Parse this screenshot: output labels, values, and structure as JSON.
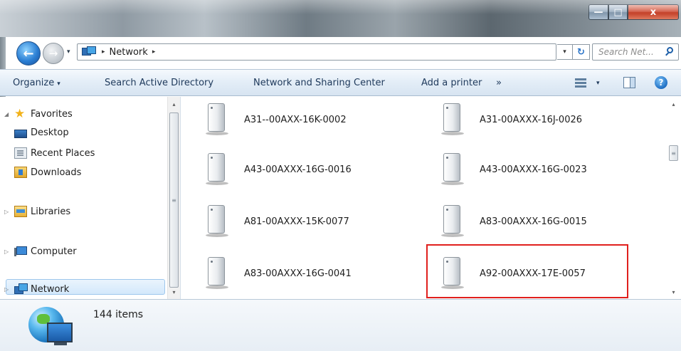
{
  "window": {
    "minimize_glyph": "—",
    "maximize_glyph": "□",
    "close_glyph": "x"
  },
  "address_bar": {
    "location": "Network",
    "separator": "▸",
    "dropdown_glyph": "▾",
    "search_placeholder": "Search Net..."
  },
  "toolbar": {
    "organize": "Organize",
    "organize_caret": "▾",
    "search_ad": "Search Active Directory",
    "network_sharing": "Network and Sharing Center",
    "add_printer": "Add a printer",
    "more": "»",
    "views_caret": "▾",
    "help": "?"
  },
  "nav_pane": {
    "favorites": "Favorites",
    "desktop": "Desktop",
    "recent_places": "Recent Places",
    "downloads": "Downloads",
    "libraries": "Libraries",
    "computer": "Computer",
    "network": "Network",
    "expanded_glyph": "◢",
    "collapsed_glyph": "▷"
  },
  "devices": [
    "A31--00AXX-16K-0002",
    "A31-00AXXX-16J-0026",
    "A43-00AXXX-16G-0016",
    "A43-00AXXX-16G-0023",
    "A81-00AXXX-15K-0077",
    "A83-00AXXX-16G-0015",
    "A83-00AXXX-16G-0041",
    "A92-00AXXX-17E-0057"
  ],
  "details": {
    "item_count": "144 items"
  },
  "scroll": {
    "up": "▴",
    "down": "▾",
    "grip": "≡"
  },
  "colors": {
    "highlight_box": "#e0201d",
    "toolbar_text": "#1e395b",
    "selection": "#d3e8fb"
  }
}
